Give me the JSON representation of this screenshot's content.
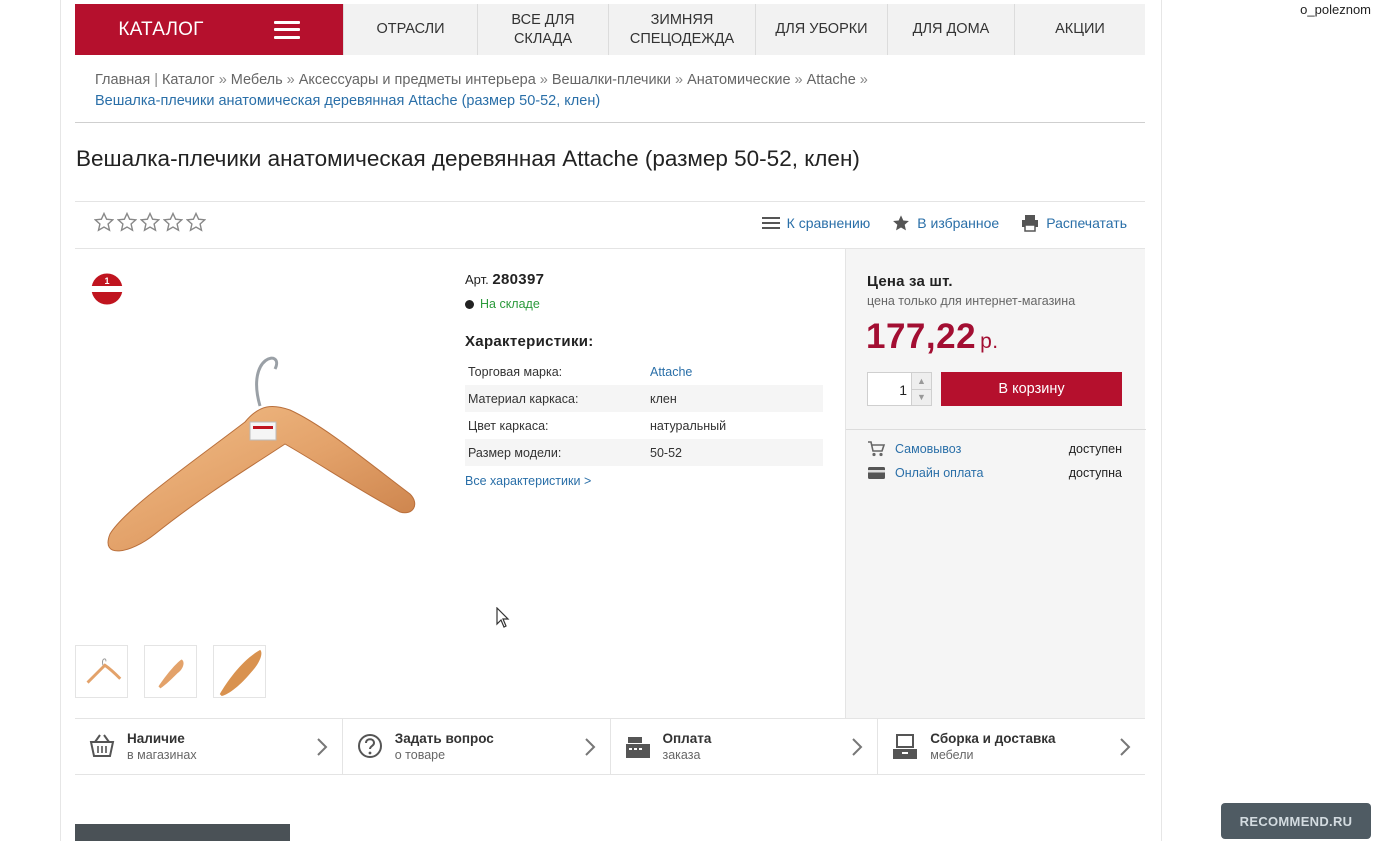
{
  "watermark_user": "o_poleznom",
  "recommend_badge": "RECOMMEND.RU",
  "nav": {
    "catalog_label": "Каталог",
    "items": [
      "Отрасли",
      "Все для\nсклада",
      "Зимняя\nспецодежда",
      "Для уборки",
      "Для дома",
      "Акции"
    ]
  },
  "breadcrumb": {
    "items": [
      "Главная",
      "Каталог",
      "Мебель",
      "Аксессуары и предметы интерьера",
      "Вешалки-плечики",
      "Анатомические",
      "Attache"
    ],
    "current": "Вешалка-плечики анатомическая деревянная Attache (размер 50-52, клен)"
  },
  "product": {
    "title": "Вешалка-плечики анатомическая деревянная Attache (размер 50-52, клен)",
    "rating_stars": 5,
    "rating_value": 0,
    "actions": {
      "compare": "К сравнению",
      "favorite": "В избранное",
      "print": "Распечатать"
    },
    "art_label": "Арт.",
    "art_value": "280397",
    "stock": "На складе",
    "specs_title": "Характеристики:",
    "specs": [
      {
        "key": "Торговая марка:",
        "value": "Attache"
      },
      {
        "key": "Материал каркаса:",
        "value": "клен"
      },
      {
        "key": "Цвет каркаса:",
        "value": "натуральный"
      },
      {
        "key": "Размер модели:",
        "value": "50-52"
      }
    ],
    "all_specs_link": "Все характеристики >"
  },
  "price": {
    "label": "Цена за шт.",
    "note": "цена только для интернет-магазина",
    "value": "177,22",
    "currency": "р.",
    "quantity": "1",
    "cart_button": "В корзину"
  },
  "delivery": [
    {
      "name": "Самовывоз",
      "status": "доступен",
      "icon": "cart-pickup-icon"
    },
    {
      "name": "Онлайн оплата",
      "status": "доступна",
      "icon": "card-icon"
    }
  ],
  "info_bar": [
    {
      "title": "Наличие",
      "subtitle": "в магазинах",
      "icon": "basket-icon"
    },
    {
      "title": "Задать вопрос",
      "subtitle": "о товаре",
      "icon": "question-icon"
    },
    {
      "title": "Оплата",
      "subtitle": "заказа",
      "icon": "cash-register-icon"
    },
    {
      "title": "Сборка и доставка",
      "subtitle": "мебели",
      "icon": "delivery-icon"
    }
  ],
  "colors": {
    "brand_red": "#b5102d",
    "price_red": "#a30e32",
    "link_blue": "#2a6fa8",
    "stock_green": "#2b9a3b"
  }
}
